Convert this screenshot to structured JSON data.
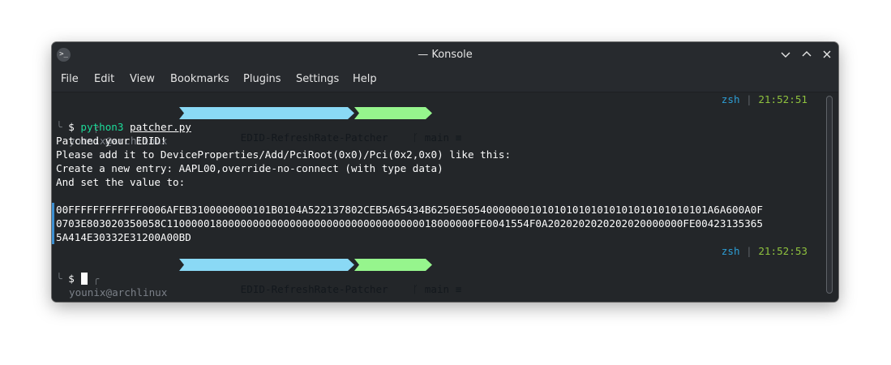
{
  "window": {
    "title": "— Konsole",
    "app_icon": ">_"
  },
  "menu": [
    "File",
    "Edit",
    "View",
    "Bookmarks",
    "Plugins",
    "Settings",
    "Help"
  ],
  "prompt1": {
    "bracket_top": "╭",
    "bracket_bottom": "╰",
    "user": "younix@archlinux",
    "dir": "EDID-RefreshRate-Patcher",
    "git": "ᚴ main ≡",
    "rprompt_shell": "zsh",
    "rprompt_sep": "|",
    "rprompt_time": "21:52:51",
    "symbol": "$",
    "command": "python3",
    "arg": "patcher.py"
  },
  "output": [
    "Patched your EDID!",
    "Please add it to DeviceProperties/Add/PciRoot(0x0)/Pci(0x2,0x0) like this:",
    "Create a new entry: AAPL00,override-no-connect (with type data)",
    "And set the value to:",
    "",
    "00FFFFFFFFFFFF0006AFEB3100000000101B0104A522137802CEB5A65434B6250E5054000000010101010101010101010101010101A6A600A0F",
    "0703E803020350058C11000001800000000000000000000000000000000018000000FE0041554F0A2020202020202020000000FE00423135365",
    "5A414E30332E31200A00BD"
  ],
  "prompt2": {
    "bracket_top": "╭",
    "bracket_bottom": "╰",
    "user": "younix@archlinux",
    "dir": "EDID-RefreshRate-Patcher",
    "git": "ᚴ main ≡",
    "rprompt_shell": "zsh",
    "rprompt_sep": "|",
    "rprompt_time": "21:52:53",
    "symbol": "$"
  },
  "colors": {
    "dir_segment": "#8ad9f5",
    "git_segment": "#96f58d",
    "accent_green": "#1cdc9a",
    "time": "#8fc23e",
    "shell": "#2d9fd6"
  }
}
